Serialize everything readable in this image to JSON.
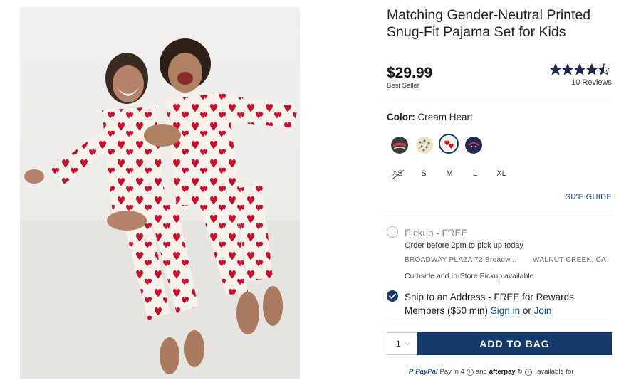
{
  "product": {
    "title": "Matching Gender-Neutral Printed Snug-Fit Pajama Set for Kids",
    "price": "$29.99",
    "badge": "Best Seller",
    "rating_value": 4.5,
    "reviews": "10 Reviews"
  },
  "color": {
    "label": "Color:",
    "value": "Cream Heart",
    "swatches": [
      {
        "name": "dark-print",
        "color": "#3b3b3b"
      },
      {
        "name": "light-dots",
        "color": "#e8d9b0"
      },
      {
        "name": "cream-heart",
        "color": "#c8102e",
        "selected": true
      },
      {
        "name": "navy-print",
        "color": "#1f2a5a"
      }
    ]
  },
  "sizes": [
    {
      "label": "XS",
      "available": false
    },
    {
      "label": "S",
      "available": true
    },
    {
      "label": "M",
      "available": true
    },
    {
      "label": "L",
      "available": true
    },
    {
      "label": "XL",
      "available": true
    }
  ],
  "size_guide": "SIZE GUIDE",
  "pickup": {
    "label": "Pickup - FREE",
    "sub": "Order before 2pm to pick up today",
    "store": "BROADWAY PLAZA 72 Broadw...",
    "city": "WALNUT CREEK, CA",
    "note": "Curbside and In-Store Pickup available"
  },
  "ship": {
    "line1": "Ship to an Address - FREE for Rewards",
    "line2_prefix": "Members ($50 min)",
    "sign_in": "Sign in",
    "or": "or",
    "join": "Join"
  },
  "cart": {
    "quantity": "1",
    "add_label": "ADD TO BAG"
  },
  "payments": {
    "paypal": "PayPal",
    "pay_in": "Pay in 4",
    "and": "and",
    "afterpay": "afterpay",
    "available": "available for"
  },
  "colors": {
    "accent": "#163a6b",
    "link": "#1a4d8c",
    "heart": "#c8102e"
  }
}
